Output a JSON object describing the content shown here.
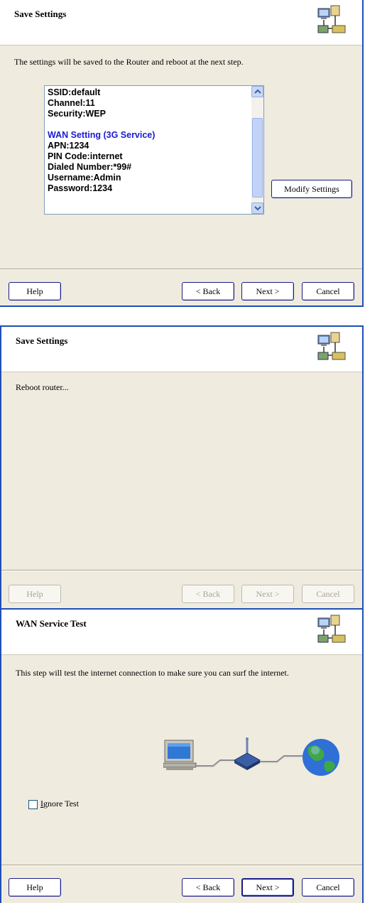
{
  "screens": [
    {
      "title": "Save Settings",
      "description": "The settings will be saved to the Router and reboot at the next step.",
      "settings_lines": [
        "SSID:default",
        "Channel:11",
        "Security:WEP",
        "",
        "WAN Setting  (3G Service)",
        "APN:1234",
        "PIN Code:internet",
        "Dialed Number:*99#",
        "Username:Admin",
        "Password:1234"
      ],
      "modify_button": "Modify Settings",
      "buttons": {
        "help": "Help",
        "back": "< Back",
        "next": "Next >",
        "cancel": "Cancel"
      }
    },
    {
      "title": "Save Settings",
      "description": "Reboot router...",
      "buttons": {
        "help": "Help",
        "back": "< Back",
        "next": "Next >",
        "cancel": "Cancel"
      },
      "buttons_enabled": false
    },
    {
      "title": "WAN Service Test",
      "description": "This step will test the internet connection to make sure you can surf the internet.",
      "ignore_test_label_underlined": "I",
      "ignore_test_label_rest": "gnore Test",
      "ignore_test_checked": false,
      "buttons": {
        "help": "Help",
        "back": "< Back",
        "next": "Next >",
        "cancel": "Cancel"
      }
    }
  ],
  "colors": {
    "wizard_border": "#1f4fb5",
    "link_blue": "#1a1ad4",
    "panel_bg": "#efebdf"
  },
  "icons": [
    "wizard-network-icon",
    "computer-icon",
    "router-icon",
    "globe-icon",
    "scroll-up-icon",
    "scroll-down-icon"
  ]
}
